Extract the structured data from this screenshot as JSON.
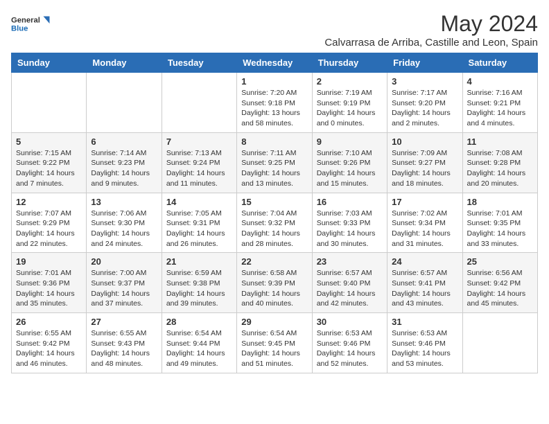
{
  "header": {
    "logo_line1": "General",
    "logo_line2": "Blue",
    "month_year": "May 2024",
    "location": "Calvarrasa de Arriba, Castille and Leon, Spain"
  },
  "weekdays": [
    "Sunday",
    "Monday",
    "Tuesday",
    "Wednesday",
    "Thursday",
    "Friday",
    "Saturday"
  ],
  "weeks": [
    [
      null,
      null,
      null,
      {
        "day": 1,
        "sunrise": "7:20 AM",
        "sunset": "9:18 PM",
        "daylight": "13 hours and 58 minutes."
      },
      {
        "day": 2,
        "sunrise": "7:19 AM",
        "sunset": "9:19 PM",
        "daylight": "14 hours and 0 minutes."
      },
      {
        "day": 3,
        "sunrise": "7:17 AM",
        "sunset": "9:20 PM",
        "daylight": "14 hours and 2 minutes."
      },
      {
        "day": 4,
        "sunrise": "7:16 AM",
        "sunset": "9:21 PM",
        "daylight": "14 hours and 4 minutes."
      }
    ],
    [
      {
        "day": 5,
        "sunrise": "7:15 AM",
        "sunset": "9:22 PM",
        "daylight": "14 hours and 7 minutes."
      },
      {
        "day": 6,
        "sunrise": "7:14 AM",
        "sunset": "9:23 PM",
        "daylight": "14 hours and 9 minutes."
      },
      {
        "day": 7,
        "sunrise": "7:13 AM",
        "sunset": "9:24 PM",
        "daylight": "14 hours and 11 minutes."
      },
      {
        "day": 8,
        "sunrise": "7:11 AM",
        "sunset": "9:25 PM",
        "daylight": "14 hours and 13 minutes."
      },
      {
        "day": 9,
        "sunrise": "7:10 AM",
        "sunset": "9:26 PM",
        "daylight": "14 hours and 15 minutes."
      },
      {
        "day": 10,
        "sunrise": "7:09 AM",
        "sunset": "9:27 PM",
        "daylight": "14 hours and 18 minutes."
      },
      {
        "day": 11,
        "sunrise": "7:08 AM",
        "sunset": "9:28 PM",
        "daylight": "14 hours and 20 minutes."
      }
    ],
    [
      {
        "day": 12,
        "sunrise": "7:07 AM",
        "sunset": "9:29 PM",
        "daylight": "14 hours and 22 minutes."
      },
      {
        "day": 13,
        "sunrise": "7:06 AM",
        "sunset": "9:30 PM",
        "daylight": "14 hours and 24 minutes."
      },
      {
        "day": 14,
        "sunrise": "7:05 AM",
        "sunset": "9:31 PM",
        "daylight": "14 hours and 26 minutes."
      },
      {
        "day": 15,
        "sunrise": "7:04 AM",
        "sunset": "9:32 PM",
        "daylight": "14 hours and 28 minutes."
      },
      {
        "day": 16,
        "sunrise": "7:03 AM",
        "sunset": "9:33 PM",
        "daylight": "14 hours and 30 minutes."
      },
      {
        "day": 17,
        "sunrise": "7:02 AM",
        "sunset": "9:34 PM",
        "daylight": "14 hours and 31 minutes."
      },
      {
        "day": 18,
        "sunrise": "7:01 AM",
        "sunset": "9:35 PM",
        "daylight": "14 hours and 33 minutes."
      }
    ],
    [
      {
        "day": 19,
        "sunrise": "7:01 AM",
        "sunset": "9:36 PM",
        "daylight": "14 hours and 35 minutes."
      },
      {
        "day": 20,
        "sunrise": "7:00 AM",
        "sunset": "9:37 PM",
        "daylight": "14 hours and 37 minutes."
      },
      {
        "day": 21,
        "sunrise": "6:59 AM",
        "sunset": "9:38 PM",
        "daylight": "14 hours and 39 minutes."
      },
      {
        "day": 22,
        "sunrise": "6:58 AM",
        "sunset": "9:39 PM",
        "daylight": "14 hours and 40 minutes."
      },
      {
        "day": 23,
        "sunrise": "6:57 AM",
        "sunset": "9:40 PM",
        "daylight": "14 hours and 42 minutes."
      },
      {
        "day": 24,
        "sunrise": "6:57 AM",
        "sunset": "9:41 PM",
        "daylight": "14 hours and 43 minutes."
      },
      {
        "day": 25,
        "sunrise": "6:56 AM",
        "sunset": "9:42 PM",
        "daylight": "14 hours and 45 minutes."
      }
    ],
    [
      {
        "day": 26,
        "sunrise": "6:55 AM",
        "sunset": "9:42 PM",
        "daylight": "14 hours and 46 minutes."
      },
      {
        "day": 27,
        "sunrise": "6:55 AM",
        "sunset": "9:43 PM",
        "daylight": "14 hours and 48 minutes."
      },
      {
        "day": 28,
        "sunrise": "6:54 AM",
        "sunset": "9:44 PM",
        "daylight": "14 hours and 49 minutes."
      },
      {
        "day": 29,
        "sunrise": "6:54 AM",
        "sunset": "9:45 PM",
        "daylight": "14 hours and 51 minutes."
      },
      {
        "day": 30,
        "sunrise": "6:53 AM",
        "sunset": "9:46 PM",
        "daylight": "14 hours and 52 minutes."
      },
      {
        "day": 31,
        "sunrise": "6:53 AM",
        "sunset": "9:46 PM",
        "daylight": "14 hours and 53 minutes."
      },
      null
    ]
  ]
}
